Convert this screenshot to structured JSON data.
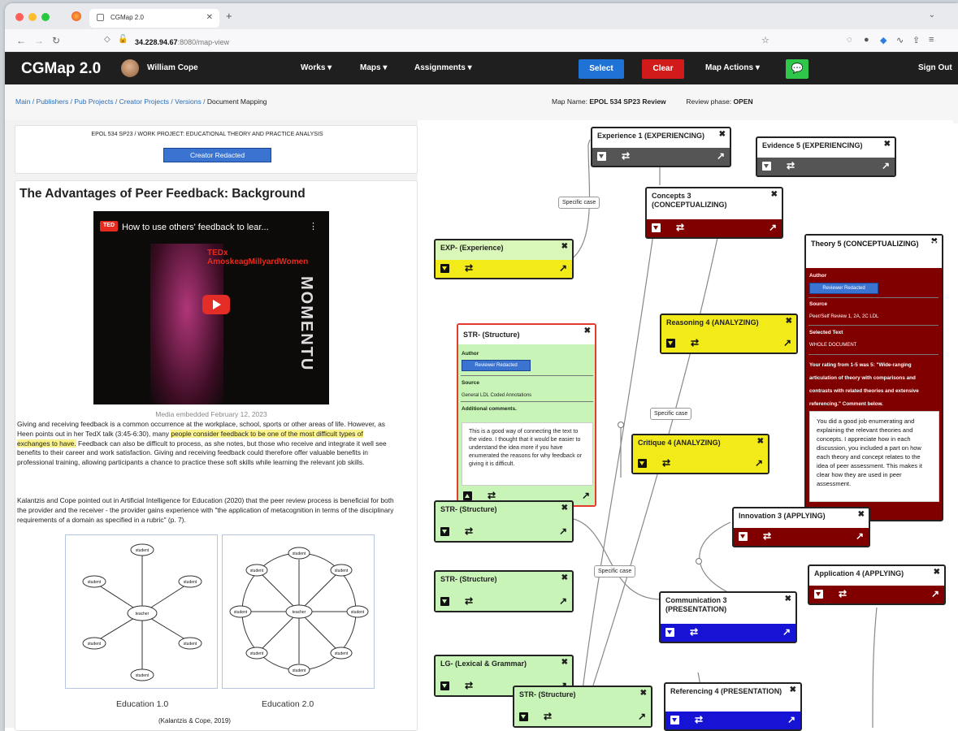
{
  "browser": {
    "tab_title": "CGMap 2.0",
    "url_host": "34.228.94.67",
    "url_rest": ":8080/map-view",
    "new_tab": "+"
  },
  "nav": {
    "brand": "CGMap 2.0",
    "user": "William Cope",
    "menus": [
      "Works",
      "Maps",
      "Assignments"
    ],
    "select": "Select",
    "clear": "Clear",
    "map_actions": "Map Actions",
    "sign_out": "Sign Out"
  },
  "breadcrumb": {
    "items": [
      "Main",
      "Publishers",
      "Pub Projects",
      "Creator Projects",
      "Versions"
    ],
    "current": "Document Mapping"
  },
  "map_meta": {
    "map_name_label": "Map Name:",
    "map_name": "EPOL 534 SP23 Review",
    "phase_label": "Review phase:",
    "phase": "OPEN"
  },
  "document": {
    "project": "EPOL 534 SP23 / WORK PROJECT: EDUCATIONAL THEORY AND PRACTICE ANALYSIS",
    "creator": "Creator Redacted",
    "title": "The Advantages of Peer Feedback: Background",
    "video_badge": "TED",
    "video_title": "How to use others' feedback to lear...",
    "video_stage_text": "MOMENTU",
    "video_tedx": "TEDx AmoskeagMillyardWomen",
    "caption": "Media embedded February 12, 2023",
    "p1_a": "Giving and receiving feedback is a common occurrence at the workplace, school, sports or other areas of life. However, as Heen points out in her TedX talk (3:45-6:30), many ",
    "p1_hl": "people consider feedback to be one of the most difficult types of exchanges to have.",
    "p1_b": " Feedback can also be difficult to process, as she notes, but those who receive and integrate it well see benefits to their career and work satisfaction. Giving and receiving feedback could therefore offer valuable benefits in professional training, allowing participants a chance to practice these soft skills while learning the relevant job skills.",
    "p2": "Kalantzis and Cope pointed out in Artificial Intelligence for Education (2020) that the peer review process is beneficial for both the provider and the receiver - the provider gains experience with \"the application of metacognition in terms of the disciplinary requirements of a domain as specified in a rubric\" (p. 7).",
    "diagram1_center": "teacher",
    "diagram2_center": "teacher",
    "diagram_node": "student",
    "label1": "Education 1.0",
    "label2": "Education 2.0",
    "citation": "(Kalantzis & Cope, 2019)"
  },
  "map": {
    "nodes": {
      "exp1": "Experience 1 (EXPERIENCING)",
      "ev5": "Evidence 5 (EXPERIENCING)",
      "con3": "Concepts 3 (CONCEPTUALIZING)",
      "expx": "EXP- (Experience)",
      "th5": "Theory 5 (CONCEPTUALIZING)",
      "rea4": "Reasoning 4 (ANALYZING)",
      "str1": "STR- (Structure)",
      "crit4": "Critique 4 (ANALYZING)",
      "str2": "STR- (Structure)",
      "inn3": "Innovation 3 (APPLYING)",
      "str3": "STR- (Structure)",
      "app4": "Application 4 (APPLYING)",
      "com3": "Communication 3 (PRESENTATION)",
      "lg": "LG- (Lexical & Grammar)",
      "str4": "STR- (Structure)",
      "ref4": "Referencing 4 (PRESENTATION)"
    },
    "edge_labels": [
      "Specific case",
      "Specific case",
      "Specific case"
    ],
    "str_detail": {
      "author_label": "Author",
      "author": "Reviewer Redacted",
      "source_label": "Source",
      "source": "General LDL Coded Annotations",
      "comments_label": "Additional comments.",
      "comment": "This is a good way of connecting the text to the video. I thought that it would be easier to understand the idea more if you have enumerated the reasons for why feedback or giving it is difficult."
    },
    "theory_detail": {
      "author_label": "Author",
      "author": "Reviewer Redacted",
      "source_label": "Source",
      "source": "Peer/Self Review 1, 2A, 2C LDL",
      "selected_label": "Selected Text",
      "selected": "WHOLE DOCUMENT",
      "rating": "Your rating from 1-5 was 5: \"Wide-ranging articulation of theory with comparisons and contrasts with related theories and extensive referencing.\" Comment below.",
      "comment": "You did a good job enumerating and explaining the relevant theories and concepts. I appreciate how in each discussion, you included a part on how each theory and concept relates to the idea of peer assessment. This makes it clear how they are used in peer assessment."
    }
  },
  "icons": {
    "close": "✖",
    "swap": "⇄",
    "external": "↗"
  },
  "colors": {
    "green_node": "#c8f4b8",
    "yellow_node": "#f3ea1a",
    "dark_node": "#555555",
    "maroon_node": "#800000",
    "blue_node": "#1713d4",
    "select_btn": "#1f73d6",
    "clear_btn": "#d11a1a",
    "chat_btn": "#2fc74a"
  }
}
